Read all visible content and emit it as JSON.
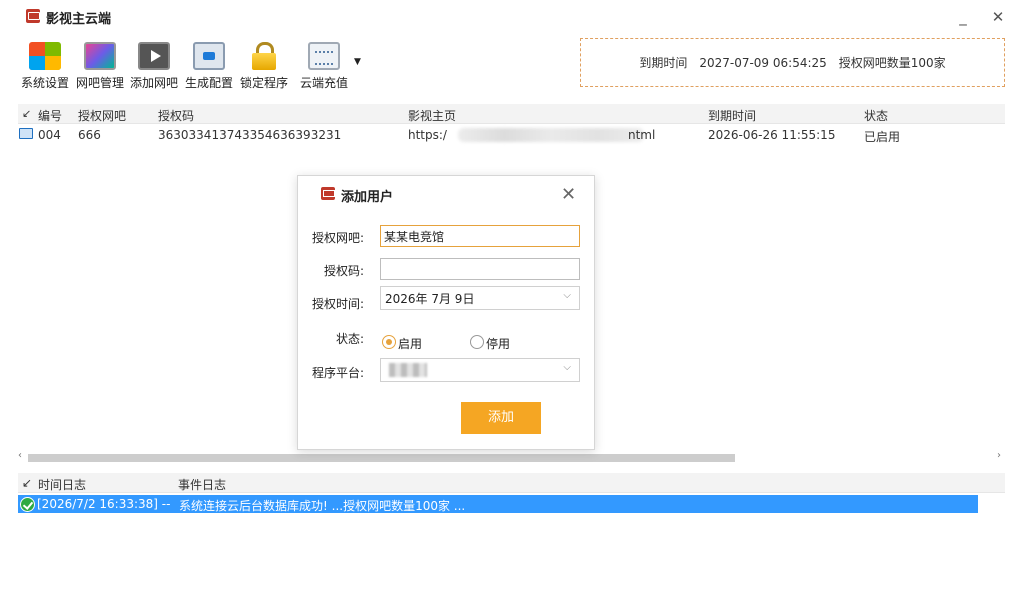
{
  "app": {
    "title": "影视主云端"
  },
  "window": {
    "minimize": "_",
    "close": "✕"
  },
  "toolbar": {
    "items": [
      {
        "label": "系统设置",
        "icon": "windows-logo-icon"
      },
      {
        "label": "网吧管理",
        "icon": "monitor-icon"
      },
      {
        "label": "添加网吧",
        "icon": "video-play-icon"
      },
      {
        "label": "生成配置",
        "icon": "config-icon"
      },
      {
        "label": "锁定程序",
        "icon": "lock-icon"
      },
      {
        "label": "云端充值",
        "icon": "cloud-recharge-icon"
      }
    ],
    "dropdown_arrow": "▼"
  },
  "expiry": {
    "expire_label": "到期时间",
    "expire_value": "2027-07-09 06:54:25",
    "quota_text": "授权网吧数量100家"
  },
  "grid": {
    "columns": [
      "编号",
      "授权网吧",
      "授权码",
      "影视主页",
      "到期时间",
      "状态"
    ],
    "rows": [
      {
        "id": "004",
        "name": "666",
        "code": "363033413743354636393231",
        "home_prefix": "https:/",
        "home_suffix": "ntml",
        "expire": "2026-06-26 11:55:15",
        "status": "已启用"
      }
    ]
  },
  "scroll": {
    "left": "‹",
    "right": "›"
  },
  "log": {
    "columns": [
      "时间日志",
      "事件日志"
    ],
    "rows": [
      {
        "time": "[2026/7/2 16:33:38] --",
        "event": "系统连接云后台数据库成功!    ...授权网吧数量100家  ..."
      }
    ]
  },
  "dialog": {
    "title": "添加用户",
    "close": "✕",
    "fields": {
      "name_label": "授权网吧:",
      "name_value": "某某电竞馆",
      "code_label": "授权码:",
      "code_value": "",
      "time_label": "授权时间:",
      "time_value": "2026年  7月  9日",
      "status_label": "状态:",
      "status_on": "启用",
      "status_off": "停用",
      "platform_label": "程序平台:"
    },
    "submit": "添加",
    "accent": "#f5a623"
  },
  "colors": {
    "selection": "#3399ff",
    "accent": "#e6a23c"
  }
}
